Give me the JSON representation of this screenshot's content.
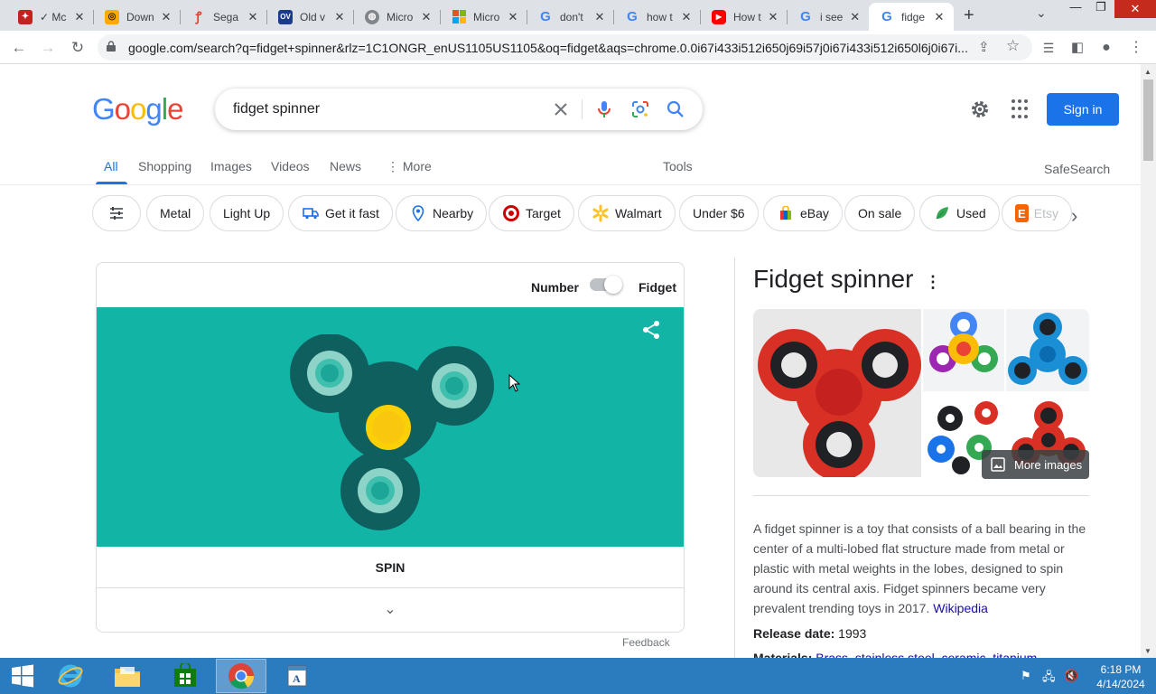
{
  "browser": {
    "tabs": [
      {
        "title": "✓ Mc",
        "color": "#c5221f",
        "glyph": "🦅"
      },
      {
        "title": "Down",
        "color": "#f9ab00",
        "glyph": "G"
      },
      {
        "title": "Sega",
        "color": "#ea4335",
        "glyph": "S"
      },
      {
        "title": "Old v",
        "color": "#1a3c8a",
        "glyph": "OV"
      },
      {
        "title": "Micro",
        "color": "#5f6368",
        "glyph": "◍"
      },
      {
        "title": "Micro",
        "color": "#f25022",
        "glyph": "▦"
      },
      {
        "title": "don't",
        "color": "#4285f4",
        "glyph": "G"
      },
      {
        "title": "how t",
        "color": "#4285f4",
        "glyph": "G"
      },
      {
        "title": "How t",
        "color": "#ff0000",
        "glyph": "▶"
      },
      {
        "title": "i see",
        "color": "#4285f4",
        "glyph": "G"
      },
      {
        "title": "fidge",
        "color": "#4285f4",
        "glyph": "G"
      }
    ],
    "new_tab": "+",
    "url": "google.com/search?q=fidget+spinner&rlz=1C1ONGR_enUS1105US1105&oq=fidget&aqs=chrome.0.0i67i433i512i650j69i57j0i67i433i512i650l6j0i67i..."
  },
  "google": {
    "logo": [
      "G",
      "o",
      "o",
      "g",
      "l",
      "e"
    ],
    "query": "fidget spinner",
    "signin": "Sign in",
    "nav": {
      "all": "All",
      "shopping": "Shopping",
      "images": "Images",
      "videos": "Videos",
      "news": "News",
      "more": "More",
      "tools": "Tools",
      "safesearch": "SafeSearch"
    },
    "chips": [
      "Metal",
      "Light Up",
      "Get it fast",
      "Nearby",
      "Target",
      "Walmart",
      "Under $6",
      "eBay",
      "On sale",
      "Used",
      "Etsy"
    ]
  },
  "widget": {
    "label_number": "Number",
    "label_fidget": "Fidget",
    "spin": "SPIN",
    "feedback": "Feedback",
    "colors": {
      "background": "#12b5a5",
      "body": "#0f5f5f",
      "center": "#fcd007",
      "bearing": "#8dd3c7"
    }
  },
  "knowledge_panel": {
    "title": "Fidget spinner",
    "more_images": "More images",
    "description": "A fidget spinner is a toy that consists of a ball bearing in the center of a multi-lobed flat structure made from metal or plastic with metal weights in the lobes, designed to spin around its central axis. Fidget spinners became very prevalent trending toys in 2017.",
    "source": "Wikipedia",
    "release_label": "Release date:",
    "release_value": "1993",
    "materials_label": "Materials:",
    "materials_value": "Brass, stainless steel, ceramic, titanium"
  },
  "taskbar": {
    "time": "6:18 PM",
    "date": "4/14/2024"
  }
}
